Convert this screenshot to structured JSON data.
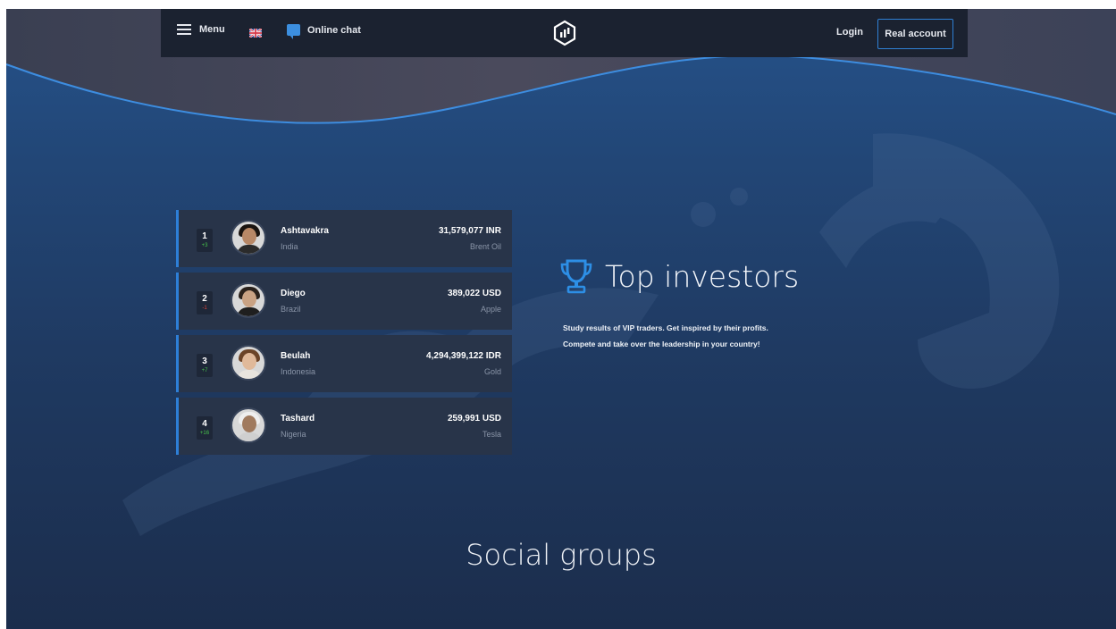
{
  "colors": {
    "accent": "#2d7fd8",
    "navbar": "#1b2230",
    "card": "#283449",
    "up": "#47c34b",
    "down": "#e0453c"
  },
  "nav": {
    "menu_label": "Menu",
    "menu_icon": "hamburger-icon",
    "flag_icon": "uk-flag-icon",
    "chat_label": "Online chat",
    "chat_icon": "chat-icon",
    "logo_icon": "brand-logo-icon",
    "login_label": "Login",
    "real_account_label": "Real account"
  },
  "investors": [
    {
      "rank": "1",
      "change": "+3",
      "trend": "up",
      "name": "Ashtavakra",
      "country": "India",
      "amount": "31,579,077 INR",
      "asset": "Brent Oil"
    },
    {
      "rank": "2",
      "change": "-1",
      "trend": "down",
      "name": "Diego",
      "country": "Brazil",
      "amount": "389,022 USD",
      "asset": "Apple"
    },
    {
      "rank": "3",
      "change": "+7",
      "trend": "up",
      "name": "Beulah",
      "country": "Indonesia",
      "amount": "4,294,399,122 IDR",
      "asset": "Gold"
    },
    {
      "rank": "4",
      "change": "+16",
      "trend": "up",
      "name": "Tashard",
      "country": "Nigeria",
      "amount": "259,991 USD",
      "asset": "Tesla"
    }
  ],
  "top": {
    "icon": "trophy-icon",
    "title": "Top investors",
    "desc_line1": "Study results of VIP traders. Get inspired by their profits.",
    "desc_line2": "Compete and take over the leadership in your country!"
  },
  "social": {
    "title": "Social groups"
  }
}
